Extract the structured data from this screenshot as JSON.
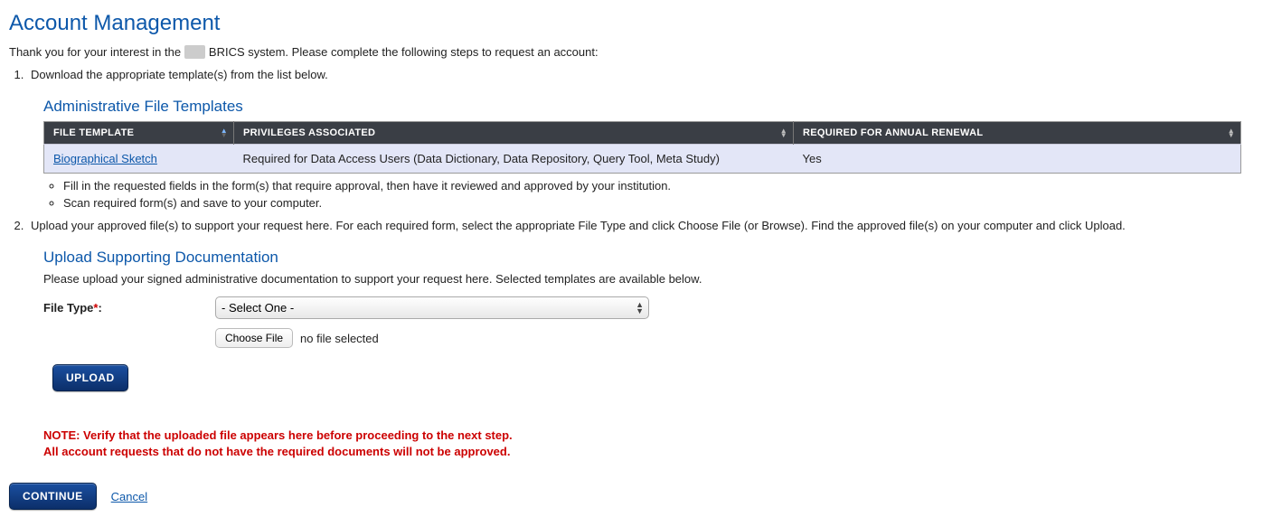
{
  "page": {
    "title": "Account Management",
    "intro_before": "Thank you for your interest in the ",
    "intro_system": "BRICS system.",
    "intro_after": " Please complete the following steps to request an account:"
  },
  "steps": {
    "s1": "Download the appropriate template(s) from the list below.",
    "s2": "Upload your approved file(s) to support your request here. For each required form, select the appropriate File Type and click Choose File (or Browse). Find the approved file(s) on your computer and click Upload.",
    "sub1": "Fill in the requested fields in the form(s) that require approval, then have it reviewed and approved by your institution.",
    "sub2": "Scan required form(s) and save to your computer."
  },
  "templates_section": {
    "heading": "Administrative File Templates",
    "cols": {
      "c1": "FILE TEMPLATE",
      "c2": "PRIVILEGES ASSOCIATED",
      "c3": "REQUIRED FOR ANNUAL RENEWAL"
    },
    "row": {
      "name": "Biographical Sketch",
      "priv": "Required for Data Access Users (Data Dictionary, Data Repository, Query Tool, Meta Study)",
      "req": "Yes"
    }
  },
  "upload_section": {
    "heading": "Upload Supporting Documentation",
    "help": "Please upload your signed administrative documentation to support your request here. Selected templates are available below.",
    "filetype_label": "File Type",
    "filetype_placeholder": "- Select One -",
    "choose_label": "Choose File",
    "nofile": "no file selected",
    "upload_button": "UPLOAD"
  },
  "note": {
    "line1": "NOTE: Verify that the uploaded file appears here before proceeding to the next step.",
    "line2": "All account requests that do not have the required documents will not be approved."
  },
  "actions": {
    "continue": "CONTINUE",
    "cancel": "Cancel"
  }
}
